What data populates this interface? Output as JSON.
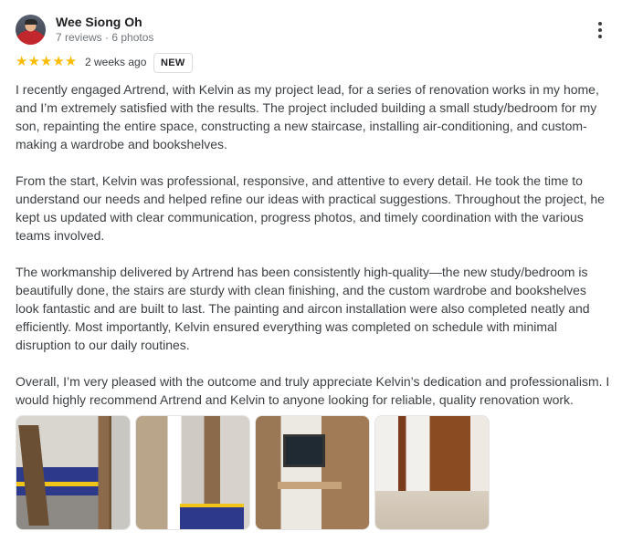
{
  "reviewer": {
    "name": "Wee Siong Oh",
    "meta": "7 reviews · 6 photos"
  },
  "rating": {
    "stars": "★★★★★",
    "value": 5,
    "date": "2 weeks ago",
    "badge": "NEW"
  },
  "review": {
    "paragraphs": [
      "I recently engaged Artrend, with Kelvin as my project lead, for a series of renovation works in my home, and I’m extremely satisfied with the results. The project included building a small study/bedroom for my son, repainting the entire space, constructing a new staircase, installing air-conditioning, and custom-making a wardrobe and bookshelves.",
      "From the start, Kelvin was professional, responsive, and attentive to every detail. He took the time to understand our needs and helped refine our ideas with practical suggestions. Throughout the project, he kept us updated with clear communication, progress photos, and timely coordination with the various teams involved.",
      "The workmanship delivered by Artrend has been consistently high-quality—the new study/bedroom is beautifully done, the stairs are sturdy with clean finishing, and the custom wardrobe and bookshelves look fantastic and are built to last. The painting and aircon installation were also completed neatly and efficiently. Most importantly, Kelvin ensured everything was completed on schedule with minimal disruption to our daily routines.",
      "Overall, I’m very pleased with the outcome and truly appreciate Kelvin’s dedication and professionalism. I would highly recommend Artrend and Kelvin to anyone looking for reliable, quality renovation work."
    ]
  },
  "icons": {
    "avatar": "avatar-photo",
    "more": "more-vert-icon",
    "star": "star-icon"
  },
  "colors": {
    "star": "#fbbc04",
    "text": "#3c4043",
    "name": "#202124",
    "meta": "#70757a"
  }
}
